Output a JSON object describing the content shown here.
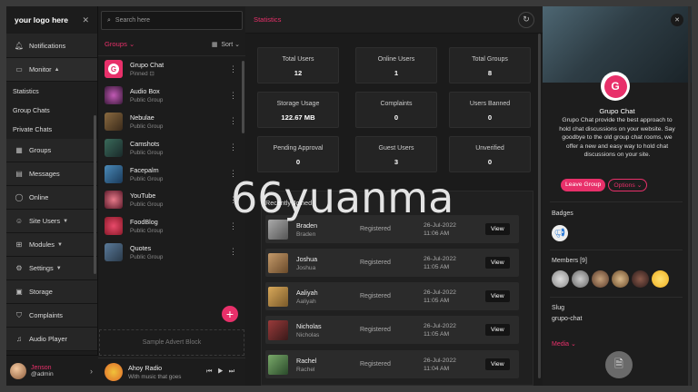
{
  "sidebar": {
    "logo": "your logo here",
    "items": [
      {
        "label": "Notifications",
        "icon": "bell-icon"
      },
      {
        "label": "Monitor",
        "icon": "monitor-icon"
      },
      {
        "label": "Statistics"
      },
      {
        "label": "Group Chats"
      },
      {
        "label": "Private Chats"
      },
      {
        "label": "Groups",
        "icon": "groups-icon"
      },
      {
        "label": "Messages",
        "icon": "messages-icon"
      },
      {
        "label": "Online",
        "icon": "online-icon"
      },
      {
        "label": "Site Users",
        "icon": "users-icon"
      },
      {
        "label": "Modules",
        "icon": "modules-icon"
      },
      {
        "label": "Settings",
        "icon": "gear-icon"
      },
      {
        "label": "Storage",
        "icon": "storage-icon"
      },
      {
        "label": "Complaints",
        "icon": "shield-icon"
      },
      {
        "label": "Audio Player",
        "icon": "audio-icon"
      }
    ],
    "user": {
      "name": "Jenson",
      "handle": "@admin"
    }
  },
  "groups_panel": {
    "search_placeholder": "Search here",
    "title": "Groups",
    "sort_label": "Sort",
    "items": [
      {
        "name": "Grupo Chat",
        "sub": "Pinned"
      },
      {
        "name": "Audio Box",
        "sub": "Public Group"
      },
      {
        "name": "Nebulae",
        "sub": "Public Group"
      },
      {
        "name": "Camshots",
        "sub": "Public Group"
      },
      {
        "name": "Facepalm",
        "sub": "Public Group"
      },
      {
        "name": "YouTube",
        "sub": "Public Group"
      },
      {
        "name": "FoodBlog",
        "sub": "Public Group"
      },
      {
        "name": "Quotes",
        "sub": "Public Group"
      }
    ],
    "advert": "Sample Advert Block",
    "player": {
      "title": "Ahoy Radio",
      "subtitle": "With music that goes"
    }
  },
  "main": {
    "title": "Statistics",
    "stats": [
      {
        "label": "Total Users",
        "value": "12"
      },
      {
        "label": "Online Users",
        "value": "1"
      },
      {
        "label": "Total Groups",
        "value": "8"
      },
      {
        "label": "Storage Usage",
        "value": "122.67 MB"
      },
      {
        "label": "Complaints",
        "value": "0"
      },
      {
        "label": "Users Banned",
        "value": "0"
      },
      {
        "label": "Pending Approval",
        "value": "0"
      },
      {
        "label": "Guest Users",
        "value": "3"
      },
      {
        "label": "Unverified",
        "value": "0"
      }
    ],
    "recent_title": "Recently Joined",
    "recent_users": [
      {
        "name": "Braden",
        "handle": "Braden",
        "status": "Registered",
        "date": "26-Jul-2022",
        "time": "11:06 AM",
        "action": "View"
      },
      {
        "name": "Joshua",
        "handle": "Joshua",
        "status": "Registered",
        "date": "26-Jul-2022",
        "time": "11:05 AM",
        "action": "View"
      },
      {
        "name": "Aaliyah",
        "handle": "Aaliyah",
        "status": "Registered",
        "date": "26-Jul-2022",
        "time": "11:05 AM",
        "action": "View"
      },
      {
        "name": "Nicholas",
        "handle": "Nicholas",
        "status": "Registered",
        "date": "26-Jul-2022",
        "time": "11:05 AM",
        "action": "View"
      },
      {
        "name": "Rachel",
        "handle": "Rachel",
        "status": "Registered",
        "date": "26-Jul-2022",
        "time": "11:04 AM",
        "action": "View"
      }
    ]
  },
  "right_panel": {
    "name": "Grupo Chat",
    "logo_letter": "G",
    "description": "Grupo Chat provide the best approach to hold chat discussions on your website. Say goodbye to the old group chat rooms, we offer a new and easy way to hold chat discussions on your site.",
    "leave_label": "Leave Group",
    "options_label": "Options",
    "badges_label": "Badges",
    "members_label": "Members [9]",
    "slug_label": "Slug",
    "slug_value": "grupo-chat",
    "media_label": "Media"
  },
  "watermark": "66yuanma",
  "colors": {
    "accent": "#e8306a",
    "background": "#1b1b1b",
    "card": "#242424"
  }
}
